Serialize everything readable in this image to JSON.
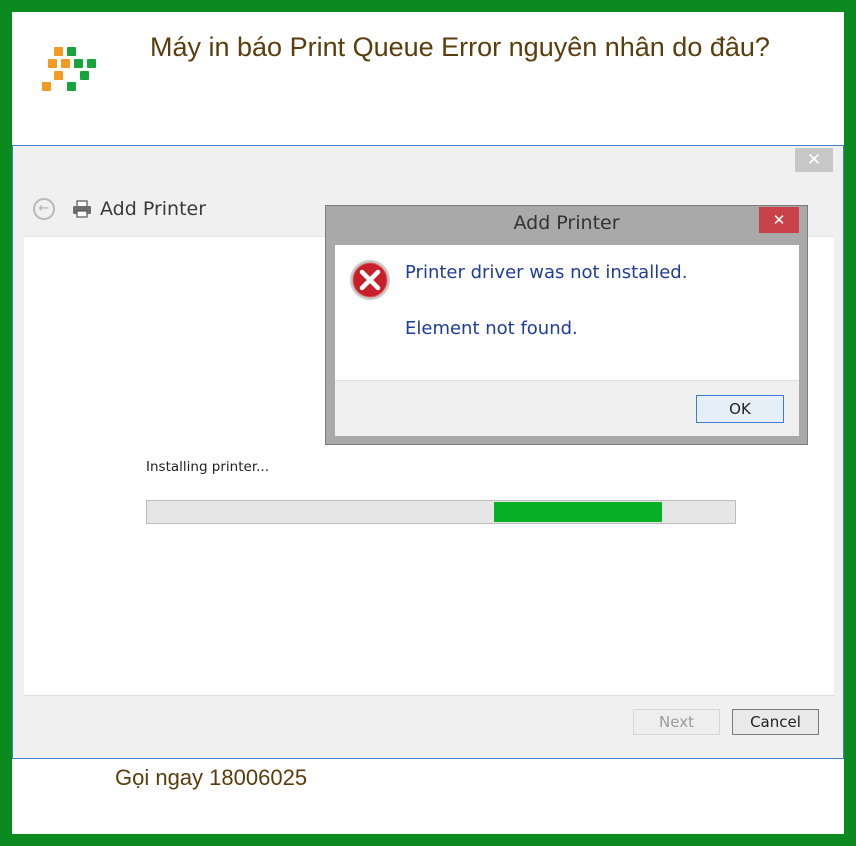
{
  "article": {
    "headline": "Máy in báo Print Queue Error nguyên nhân do đâu?",
    "footer_text": "Gọi ngay 18006025",
    "brand_colors": {
      "frame": "#0b8a1f",
      "text": "#5a3d0c"
    }
  },
  "logo": {
    "icon": "pixel-arrow-logo",
    "colors": [
      "#f29a21",
      "#17a43b"
    ]
  },
  "window": {
    "close_glyph": "✕",
    "back_icon": "back-arrow-icon",
    "printer_icon": "printer-icon",
    "title": "Add Printer",
    "status_text": "Installing printer...",
    "progress": {
      "start_fraction": 0.59,
      "end_fraction": 0.875,
      "color": "#06b025"
    },
    "buttons": {
      "next": "Next",
      "cancel": "Cancel"
    }
  },
  "dialog": {
    "title": "Add Printer",
    "close_glyph": "✕",
    "icon": "error-icon",
    "message_1": "Printer driver was not installed.",
    "message_2": "Element not found.",
    "ok_label": "OK"
  }
}
